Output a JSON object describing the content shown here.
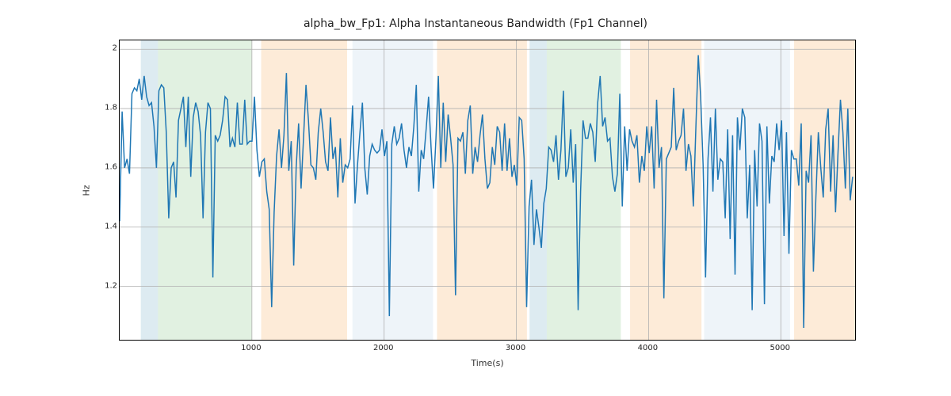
{
  "chart_data": {
    "type": "line",
    "title": "alpha_bw_Fp1: Alpha Instantaneous Bandwidth (Fp1 Channel)",
    "xlabel": "Time(s)",
    "ylabel": "Hz",
    "xlim": [
      0,
      5561.8
    ],
    "ylim": [
      1.02,
      2.03
    ],
    "xticks": [
      1000,
      2000,
      3000,
      4000,
      5000
    ],
    "yticks": [
      1.2,
      1.4,
      1.6,
      1.8,
      2.0
    ],
    "bands": [
      {
        "x0": 160,
        "x1": 290,
        "color": "#9ec6d7"
      },
      {
        "x0": 290,
        "x1": 1000,
        "color": "#a8d8a8"
      },
      {
        "x0": 1070,
        "x1": 1720,
        "color": "#f9c78e"
      },
      {
        "x0": 1760,
        "x1": 2370,
        "color": "#cfe0ee"
      },
      {
        "x0": 2400,
        "x1": 3080,
        "color": "#f9c78e"
      },
      {
        "x0": 3100,
        "x1": 3230,
        "color": "#9ec6d7"
      },
      {
        "x0": 3230,
        "x1": 3790,
        "color": "#a8d8a8"
      },
      {
        "x0": 3860,
        "x1": 4400,
        "color": "#f9c78e"
      },
      {
        "x0": 4420,
        "x1": 5070,
        "color": "#cfe0ee"
      },
      {
        "x0": 5100,
        "x1": 5561.8,
        "color": "#f9c78e"
      }
    ],
    "series": [
      {
        "name": "alpha_bw_Fp1",
        "x_step": 18.54,
        "values": [
          1.42,
          1.79,
          1.6,
          1.63,
          1.58,
          1.85,
          1.87,
          1.86,
          1.9,
          1.83,
          1.91,
          1.84,
          1.81,
          1.82,
          1.74,
          1.6,
          1.86,
          1.88,
          1.87,
          1.72,
          1.43,
          1.6,
          1.62,
          1.5,
          1.76,
          1.8,
          1.84,
          1.67,
          1.84,
          1.57,
          1.77,
          1.82,
          1.79,
          1.71,
          1.43,
          1.72,
          1.82,
          1.8,
          1.23,
          1.71,
          1.69,
          1.71,
          1.76,
          1.84,
          1.83,
          1.67,
          1.7,
          1.67,
          1.82,
          1.68,
          1.68,
          1.83,
          1.68,
          1.69,
          1.69,
          1.84,
          1.66,
          1.57,
          1.62,
          1.63,
          1.52,
          1.46,
          1.13,
          1.45,
          1.64,
          1.73,
          1.6,
          1.71,
          1.92,
          1.59,
          1.69,
          1.27,
          1.6,
          1.75,
          1.53,
          1.7,
          1.88,
          1.76,
          1.61,
          1.6,
          1.56,
          1.72,
          1.8,
          1.72,
          1.62,
          1.59,
          1.77,
          1.63,
          1.67,
          1.5,
          1.7,
          1.55,
          1.61,
          1.6,
          1.63,
          1.81,
          1.48,
          1.61,
          1.72,
          1.82,
          1.6,
          1.51,
          1.64,
          1.68,
          1.66,
          1.65,
          1.66,
          1.73,
          1.64,
          1.69,
          1.1,
          1.68,
          1.74,
          1.68,
          1.7,
          1.75,
          1.66,
          1.6,
          1.67,
          1.64,
          1.74,
          1.88,
          1.52,
          1.66,
          1.63,
          1.73,
          1.84,
          1.67,
          1.53,
          1.7,
          1.91,
          1.6,
          1.82,
          1.62,
          1.78,
          1.7,
          1.61,
          1.17,
          1.7,
          1.69,
          1.72,
          1.58,
          1.76,
          1.81,
          1.58,
          1.67,
          1.62,
          1.71,
          1.78,
          1.63,
          1.53,
          1.55,
          1.67,
          1.61,
          1.74,
          1.72,
          1.59,
          1.75,
          1.59,
          1.7,
          1.57,
          1.61,
          1.54,
          1.77,
          1.76,
          1.63,
          1.13,
          1.47,
          1.56,
          1.34,
          1.46,
          1.4,
          1.33,
          1.48,
          1.53,
          1.67,
          1.66,
          1.62,
          1.71,
          1.56,
          1.66,
          1.86,
          1.57,
          1.6,
          1.73,
          1.55,
          1.68,
          1.12,
          1.52,
          1.76,
          1.7,
          1.7,
          1.75,
          1.72,
          1.62,
          1.82,
          1.91,
          1.74,
          1.77,
          1.69,
          1.7,
          1.57,
          1.52,
          1.58,
          1.85,
          1.47,
          1.74,
          1.59,
          1.73,
          1.69,
          1.67,
          1.71,
          1.55,
          1.64,
          1.59,
          1.74,
          1.65,
          1.74,
          1.53,
          1.83,
          1.6,
          1.67,
          1.16,
          1.63,
          1.65,
          1.67,
          1.87,
          1.66,
          1.69,
          1.71,
          1.8,
          1.59,
          1.68,
          1.64,
          1.47,
          1.73,
          1.98,
          1.84,
          1.61,
          1.23,
          1.63,
          1.77,
          1.52,
          1.8,
          1.56,
          1.63,
          1.62,
          1.43,
          1.73,
          1.36,
          1.71,
          1.24,
          1.77,
          1.66,
          1.8,
          1.77,
          1.43,
          1.61,
          1.12,
          1.66,
          1.47,
          1.75,
          1.69,
          1.14,
          1.74,
          1.48,
          1.64,
          1.62,
          1.75,
          1.66,
          1.76,
          1.37,
          1.72,
          1.31,
          1.66,
          1.63,
          1.63,
          1.54,
          1.75,
          1.06,
          1.59,
          1.55,
          1.71,
          1.25,
          1.5,
          1.72,
          1.6,
          1.5,
          1.73,
          1.8,
          1.52,
          1.71,
          1.45,
          1.65,
          1.83,
          1.72,
          1.53,
          1.8,
          1.49,
          1.57
        ]
      }
    ]
  }
}
